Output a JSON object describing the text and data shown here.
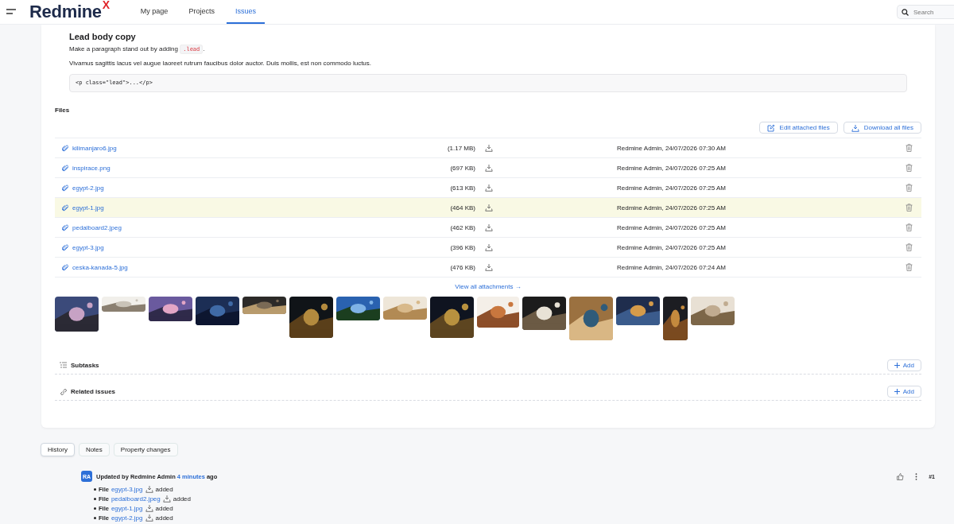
{
  "header": {
    "logo": "Redmine",
    "logo_mark": "X",
    "nav": [
      {
        "label": "My page",
        "selected": false
      },
      {
        "label": "Projects",
        "selected": false
      },
      {
        "label": "Issues",
        "selected": true
      }
    ],
    "search": {
      "placeholder": "Search"
    }
  },
  "lead": {
    "title": "Lead body copy",
    "intro": "Make a paragraph stand out by adding ",
    "intro_code": ".lead",
    "intro_end": ".",
    "paragraph": "Vivamus sagittis lacus vel augue laoreet rutrum faucibus dolor auctor. Duis mollis, est non commodo luctus.",
    "code": "<p class=\"lead\">...</p>"
  },
  "files": {
    "title": "Files",
    "actions": [
      "Edit attached files",
      "Download all files"
    ],
    "rows": [
      {
        "name": "kilimanjaro6.jpg",
        "size": "(1.17 MB)",
        "author": "Redmine Admin, 24/07/2026 07:30 AM",
        "highlighted": false
      },
      {
        "name": "inspirace.png",
        "size": "(697 KB)",
        "author": "Redmine Admin, 24/07/2026 07:25 AM",
        "highlighted": false
      },
      {
        "name": "egypt-2.jpg",
        "size": "(613 KB)",
        "author": "Redmine Admin, 24/07/2026 07:25 AM",
        "highlighted": false
      },
      {
        "name": "egypt-1.jpg",
        "size": "(464 KB)",
        "author": "Redmine Admin, 24/07/2026 07:25 AM",
        "highlighted": true
      },
      {
        "name": "pedalboard2.jpeg",
        "size": "(462 KB)",
        "author": "Redmine Admin, 24/07/2026 07:25 AM",
        "highlighted": false
      },
      {
        "name": "egypt-3.jpg",
        "size": "(396 KB)",
        "author": "Redmine Admin, 24/07/2026 07:25 AM",
        "highlighted": false
      },
      {
        "name": "ceska-kanada-5.jpg",
        "size": "(476 KB)",
        "author": "Redmine Admin, 24/07/2026 07:24 AM",
        "highlighted": false
      }
    ],
    "view_all": "View all attachments →",
    "thumbnails": [
      {
        "kind": "picture"
      },
      {
        "kind": "picture"
      },
      {
        "kind": "picture"
      },
      {
        "kind": "picture"
      },
      {
        "kind": "picture"
      },
      {
        "kind": "picture"
      },
      {
        "kind": "picture"
      },
      {
        "kind": "picture"
      },
      {
        "kind": "picture"
      },
      {
        "kind": "picture"
      },
      {
        "kind": "picture"
      },
      {
        "kind": "picture"
      },
      {
        "kind": "picture"
      },
      {
        "kind": "picture"
      },
      {
        "kind": "picture"
      }
    ]
  },
  "sections": [
    {
      "kind": "subtasks",
      "title": "Subtasks",
      "button": "Add"
    },
    {
      "kind": "related",
      "title": "Related issues",
      "button": "Add"
    }
  ],
  "history_tabs": [
    {
      "label": "History",
      "selected": true
    },
    {
      "label": "Notes",
      "selected": false
    },
    {
      "label": "Property changes",
      "selected": false
    }
  ],
  "journal": {
    "avatar": "RA",
    "prefix": "Updated by Redmine Admin",
    "time": "4 minutes",
    "suffix": "ago",
    "number": "#1",
    "changes": [
      {
        "label": "File",
        "file": "egypt-3.jpg",
        "action": "added"
      },
      {
        "label": "File",
        "file": "pedalboard2.jpeg",
        "action": "added"
      },
      {
        "label": "File",
        "file": "egypt-1.jpg",
        "action": "added"
      },
      {
        "label": "File",
        "file": "egypt-2.jpg",
        "action": "added"
      }
    ]
  }
}
